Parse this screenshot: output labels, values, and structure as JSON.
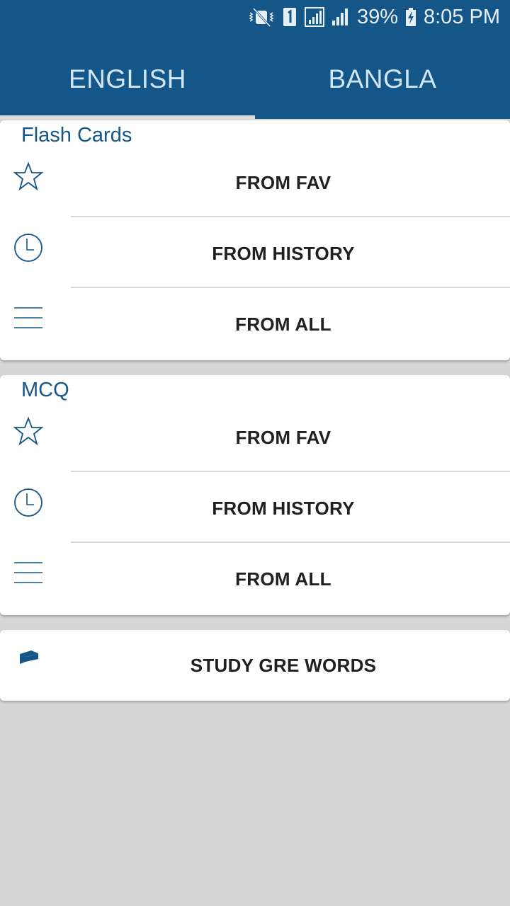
{
  "status_bar": {
    "battery": "39%",
    "time": "8:05 PM",
    "icons": [
      "mute-icon",
      "sim-1-icon",
      "signal-icon",
      "signal-icon",
      "battery-charging-icon"
    ]
  },
  "tabs": [
    {
      "label": "ENGLISH",
      "selected": true
    },
    {
      "label": "BANGLA",
      "selected": false
    }
  ],
  "flash_cards": {
    "title": "Flash Cards",
    "items": [
      {
        "label": "FROM FAV",
        "icon": "star-icon"
      },
      {
        "label": "FROM HISTORY",
        "icon": "clock-icon"
      },
      {
        "label": "FROM ALL",
        "icon": "list-icon"
      }
    ]
  },
  "mcq": {
    "title": "MCQ",
    "items": [
      {
        "label": "FROM FAV",
        "icon": "star-icon"
      },
      {
        "label": "FROM HISTORY",
        "icon": "clock-icon"
      },
      {
        "label": "FROM ALL",
        "icon": "list-icon"
      }
    ]
  },
  "study": {
    "label": "STUDY GRE WORDS",
    "icon": "graduation-cap-icon"
  },
  "colors": {
    "primary": "#155688",
    "background": "#d6d6d6",
    "tab_text": "#cfe6f7"
  }
}
